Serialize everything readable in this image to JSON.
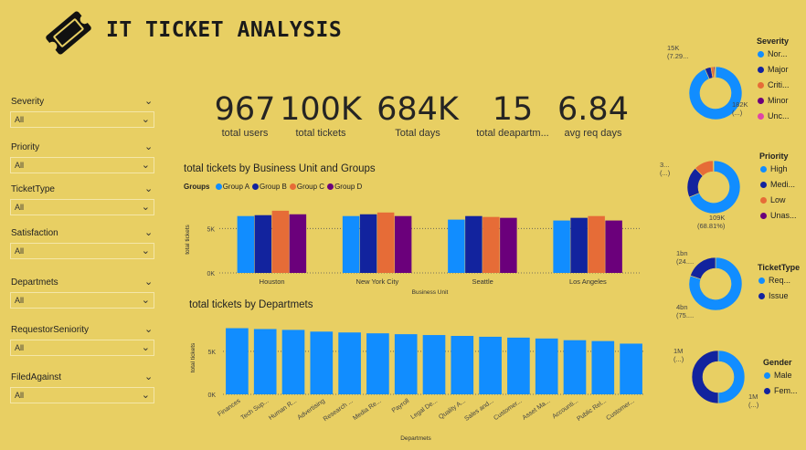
{
  "header": {
    "title": "IT TICKET ANALYSIS",
    "logo_icon": "ticket-icon"
  },
  "slicers": [
    {
      "label": "Severity",
      "value": "All"
    },
    {
      "label": "Priority",
      "value": "All"
    },
    {
      "label": "TicketType",
      "value": "All"
    },
    {
      "label": "Satisfaction",
      "value": "All"
    },
    {
      "label": "Departmets",
      "value": "All"
    },
    {
      "label": "RequestorSeniority",
      "value": "All"
    },
    {
      "label": "FiledAgainst",
      "value": "All"
    }
  ],
  "kpis": [
    {
      "value": "967",
      "label": "total users"
    },
    {
      "value": "100K",
      "label": "total tickets"
    },
    {
      "value": "684K",
      "label": "Total days"
    },
    {
      "value": "15",
      "label": "total deapartm..."
    },
    {
      "value": "6.84",
      "label": "avg req days"
    }
  ],
  "colors": {
    "group_a": "#118dff",
    "group_b": "#12239e",
    "group_c": "#e66c37",
    "group_d": "#6b007b",
    "dept_bar": "#118dff",
    "background": "#e8cf63",
    "pink": "#e044a7"
  },
  "chart_data": [
    {
      "type": "bar",
      "title": "total tickets by Business Unit and Groups",
      "legend_title": "Groups",
      "categories": [
        "Houston",
        "New York City",
        "Seattle",
        "Los Angeles"
      ],
      "series": [
        {
          "name": "Group A",
          "values": [
            6400,
            6400,
            6000,
            5900
          ]
        },
        {
          "name": "Group B",
          "values": [
            6500,
            6600,
            6400,
            6200
          ]
        },
        {
          "name": "Group C",
          "values": [
            7000,
            6800,
            6300,
            6400
          ]
        },
        {
          "name": "Group D",
          "values": [
            6600,
            6400,
            6200,
            5900
          ]
        }
      ],
      "xlabel": "Business Unit",
      "ylabel": "total tickets",
      "yticks": [
        "0K",
        "5K"
      ],
      "ylim": [
        0,
        7500
      ],
      "legend_position": "top-left"
    },
    {
      "type": "bar",
      "title": "total tickets by Departmets",
      "categories": [
        "Finances",
        "Tech Sup...",
        "Human R...",
        "Advertising",
        "Research ...",
        "Media Re...",
        "Payroll",
        "Legal De...",
        "Quality A...",
        "Sales and...",
        "Customer...",
        "Asset Ma...",
        "Accounti...",
        "Public Rel...",
        "Customer..."
      ],
      "values": [
        7700,
        7600,
        7500,
        7300,
        7200,
        7100,
        7000,
        6900,
        6800,
        6700,
        6600,
        6500,
        6300,
        6200,
        5900
      ],
      "xlabel": "Departmets",
      "ylabel": "total tickets",
      "yticks": [
        "0K",
        "5K"
      ],
      "ylim": [
        0,
        8500
      ]
    },
    {
      "type": "pie",
      "title": "Severity",
      "categories": [
        "Nor...",
        "Major",
        "Criti...",
        "Minor",
        "Unc..."
      ],
      "values": [
        182000,
        7290,
        3200,
        1500,
        800
      ],
      "colors": [
        "#118dff",
        "#12239e",
        "#e66c37",
        "#6b007b",
        "#e044a7"
      ],
      "data_labels": [
        {
          "line1": "182K",
          "line2": "(...)"
        },
        {
          "line1": "15K",
          "line2": "(7.29..."
        }
      ]
    },
    {
      "type": "pie",
      "title": "Priority",
      "categories": [
        "High",
        "Medi...",
        "Low",
        "Unas..."
      ],
      "values": [
        109000,
        30000,
        19000,
        500
      ],
      "colors": [
        "#118dff",
        "#12239e",
        "#e66c37",
        "#6b007b"
      ],
      "data_labels": [
        {
          "line1": "109K",
          "line2": "(68.81%)"
        },
        {
          "line1": "3...",
          "line2": "(...)"
        }
      ]
    },
    {
      "type": "pie",
      "title": "TicketType",
      "categories": [
        "Req...",
        "Issue"
      ],
      "values": [
        4000000000,
        1000000000
      ],
      "colors": [
        "#118dff",
        "#12239e"
      ],
      "data_labels": [
        {
          "line1": "1bn",
          "line2": "(24...."
        },
        {
          "line1": "4bn",
          "line2": "(75...."
        }
      ]
    },
    {
      "type": "pie",
      "title": "Gender",
      "categories": [
        "Male",
        "Fem..."
      ],
      "values": [
        1000000,
        1000000
      ],
      "colors": [
        "#118dff",
        "#12239e"
      ],
      "data_labels": [
        {
          "line1": "1M",
          "line2": "(...)"
        },
        {
          "line1": "1M",
          "line2": "(...)"
        }
      ]
    }
  ]
}
